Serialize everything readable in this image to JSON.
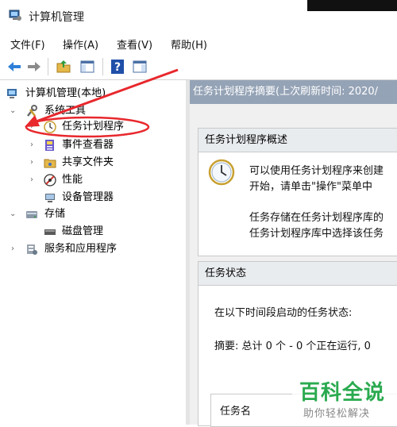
{
  "window": {
    "title": "计算机管理"
  },
  "menu": {
    "items": [
      "文件(F)",
      "操作(A)",
      "查看(V)",
      "帮助(H)"
    ]
  },
  "toolbar": {
    "icons": [
      "back-icon",
      "forward-icon",
      "up-folder-icon",
      "show-hide-tree-icon",
      "help-icon",
      "show-action-pane-icon"
    ]
  },
  "tree": {
    "root": "计算机管理(本地)",
    "system_tools": "系统工具",
    "task_scheduler": "任务计划程序",
    "event_viewer": "事件查看器",
    "shared_folders": "共享文件夹",
    "performance": "性能",
    "device_manager": "设备管理器",
    "storage": "存储",
    "disk_management": "磁盘管理",
    "services_apps": "服务和应用程序"
  },
  "right": {
    "header": "任务计划程序摘要(上次刷新时间: 2020/",
    "overview": {
      "title": "任务计划程序概述",
      "line1": "可以使用任务计划程序来创建",
      "line2": "开始，请单击\"操作\"菜单中",
      "line3": "任务存储在任务计划程序库的",
      "line4": "任务计划程序库中选择该任务"
    },
    "status": {
      "title": "任务状态",
      "line1": "在以下时间段启动的任务状态:",
      "summary": "摘要: 总计 0 个 - 0 个正在运行, 0",
      "col_task_name": "任务名"
    }
  },
  "watermark": {
    "title": "百科全说",
    "subtitle": "助你轻松解决"
  },
  "colors": {
    "header_bg": "#95a3b6",
    "annotation": "#e8282d",
    "watermark_green": "#2aaa4f"
  }
}
